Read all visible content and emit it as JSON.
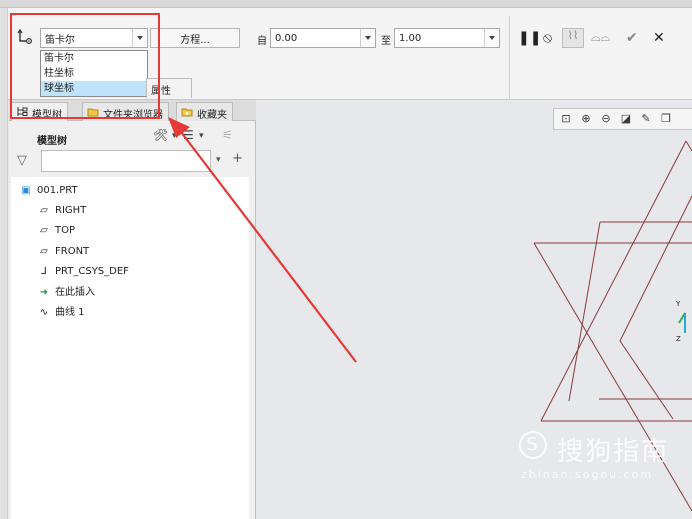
{
  "ribbon": {
    "coord_system": "笛卡尔",
    "coord_options": [
      "笛卡尔",
      "柱坐标",
      "球坐标"
    ],
    "equation_button": "方程...",
    "from_label": "自",
    "from_value": "0.00",
    "to_label": "至",
    "to_value": "1.00",
    "properties_tab": "属性"
  },
  "panel": {
    "tabs": [
      "模型树",
      "文件夹浏览器",
      "收藏夹"
    ],
    "tree_title": "模型树",
    "filter_placeholder": ""
  },
  "tree": {
    "root": "001.PRT",
    "items": [
      "RIGHT",
      "TOP",
      "FRONT",
      "PRT_CSYS_DEF",
      "在此插入",
      "曲线 1"
    ]
  },
  "viewport": {
    "axis_labels": [
      "Y",
      "Z"
    ]
  },
  "watermark": {
    "main": "搜狗指南",
    "sub": "zhinan.sogou.com"
  },
  "colors": {
    "highlight": "#e53935",
    "curve": "#8a3a3a",
    "selection": "#bfe3fb"
  }
}
